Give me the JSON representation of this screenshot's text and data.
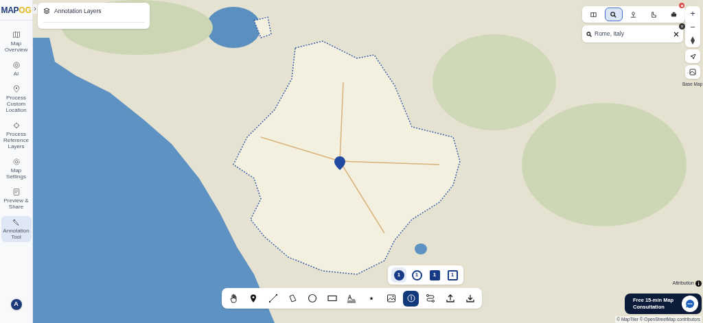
{
  "logo": {
    "parts": [
      "MAP",
      "OG"
    ]
  },
  "sidebar": {
    "items": [
      {
        "kind": "map",
        "label": "Map Overview",
        "selected": false
      },
      {
        "kind": "ai",
        "label": "AI",
        "selected": false
      },
      {
        "kind": "pin",
        "label": "Process Custom Location",
        "selected": false
      },
      {
        "kind": "layers",
        "label": "Process Reference Layers",
        "selected": false
      },
      {
        "kind": "gear",
        "label": "Map Settings",
        "selected": false
      },
      {
        "kind": "share",
        "label": "Preview & Share",
        "selected": false
      },
      {
        "kind": "annotate",
        "label": "Annotation Tool",
        "selected": true
      }
    ],
    "avatar": "A"
  },
  "layers_panel": {
    "title": "Annotation Layers"
  },
  "map_toolbar": [
    {
      "kind": "measure",
      "selected": false
    },
    {
      "kind": "search",
      "selected": true
    },
    {
      "kind": "place",
      "selected": false
    },
    {
      "kind": "boot",
      "selected": false
    },
    {
      "kind": "print",
      "selected": false
    }
  ],
  "search": {
    "value": "Rome, Italy"
  },
  "zoom": {
    "in": "+",
    "out": "−"
  },
  "base_map": {
    "label": "Base Map"
  },
  "number_styles": [
    {
      "kind": "circle-filled",
      "label": "1",
      "selected": true
    },
    {
      "kind": "circle-outline",
      "label": "1",
      "selected": false
    },
    {
      "kind": "square-filled",
      "label": "1",
      "selected": false
    },
    {
      "kind": "square-outline",
      "label": "1",
      "selected": false
    }
  ],
  "tools": [
    {
      "kind": "hand",
      "selected": false
    },
    {
      "kind": "marker",
      "selected": false
    },
    {
      "kind": "line",
      "selected": false
    },
    {
      "kind": "polygon",
      "selected": false
    },
    {
      "kind": "circle",
      "selected": false
    },
    {
      "kind": "rectangle",
      "selected": false
    },
    {
      "kind": "text",
      "selected": false
    },
    {
      "kind": "star",
      "selected": false
    },
    {
      "kind": "image",
      "selected": false
    },
    {
      "kind": "number",
      "selected": true
    },
    {
      "kind": "route",
      "selected": false
    },
    {
      "kind": "upload",
      "selected": false
    },
    {
      "kind": "download",
      "selected": false
    }
  ],
  "attribution_label": "Attribution",
  "consultation": "Free 15-min Map Consultation",
  "credits": "© MapTiler © OpenStreetMap contributors"
}
